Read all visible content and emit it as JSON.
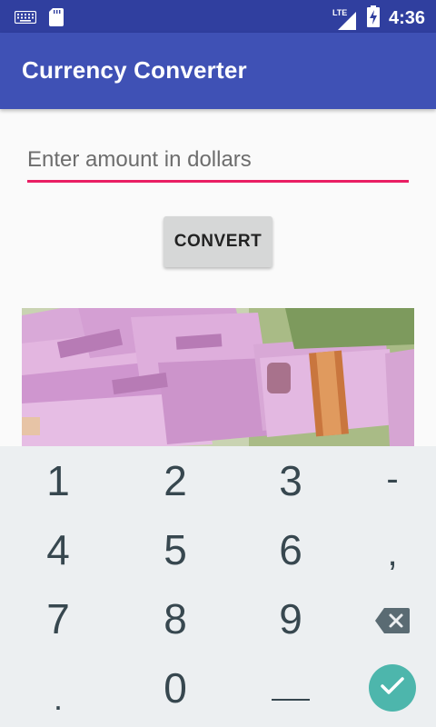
{
  "status_bar": {
    "network_label": "LTE",
    "time": "4:36",
    "icons": [
      "keyboard-icon",
      "sd-card-icon",
      "signal-icon",
      "battery-charging-icon"
    ]
  },
  "app_bar": {
    "title": "Currency Converter"
  },
  "form": {
    "amount_placeholder": "Enter amount in dollars",
    "amount_value": "",
    "convert_label": "CONVERT",
    "accent_color": "#e91e63"
  },
  "image": {
    "description_icon": "rupee-banknotes-image"
  },
  "keyboard": {
    "rows": [
      [
        "1",
        "2",
        "3",
        "-"
      ],
      [
        "4",
        "5",
        "6",
        ","
      ],
      [
        "7",
        "8",
        "9",
        "⌫"
      ],
      [
        ".",
        "0",
        "␣",
        "✓"
      ]
    ],
    "key_1": "1",
    "key_2": "2",
    "key_3": "3",
    "key_minus": "-",
    "key_4": "4",
    "key_5": "5",
    "key_6": "6",
    "key_comma": ",",
    "key_7": "7",
    "key_8": "8",
    "key_9": "9",
    "key_period": ".",
    "key_0": "0",
    "icons": [
      "backspace-icon",
      "space-icon",
      "done-check-icon"
    ]
  },
  "colors": {
    "status_bar": "#303f9f",
    "app_bar": "#3f51b5",
    "button": "#d6d7d7",
    "keyboard_bg": "#eceff1",
    "done_key": "#4db6ac"
  }
}
